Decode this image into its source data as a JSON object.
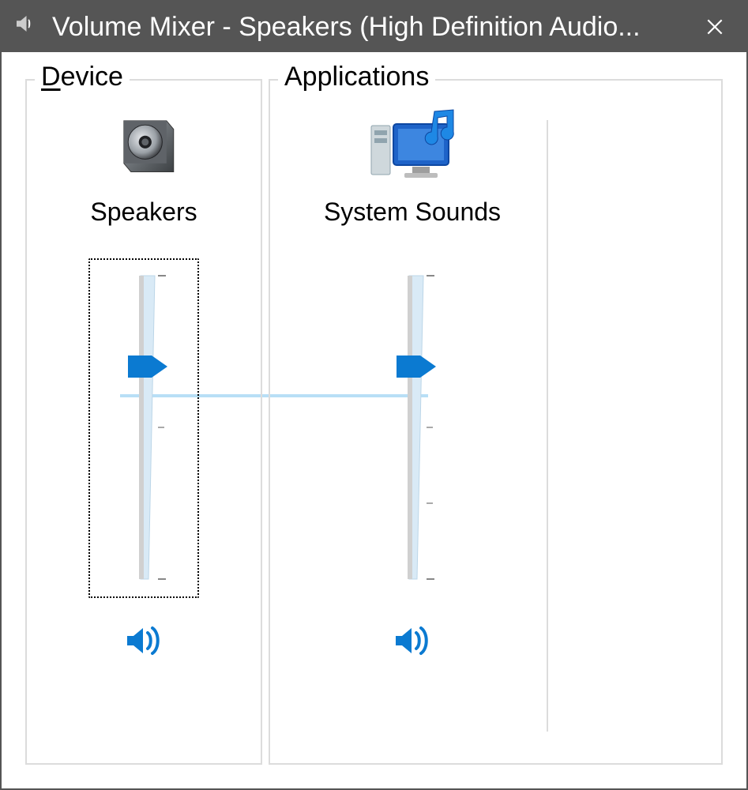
{
  "window": {
    "title": "Volume Mixer - Speakers (High Definition Audio..."
  },
  "groups": {
    "device_label_pre": "",
    "device_label_u": "D",
    "device_label_post": "evice",
    "apps_label": "Applications"
  },
  "channels": {
    "device": {
      "name": "Speakers",
      "volume_percent": 70,
      "muted": false,
      "focused": true
    },
    "system_sounds": {
      "name": "System Sounds",
      "volume_percent": 70,
      "muted": false,
      "focused": false
    }
  },
  "colors": {
    "accent": "#0078d7",
    "titlebar": "#555555",
    "border": "#dcdcdc"
  }
}
